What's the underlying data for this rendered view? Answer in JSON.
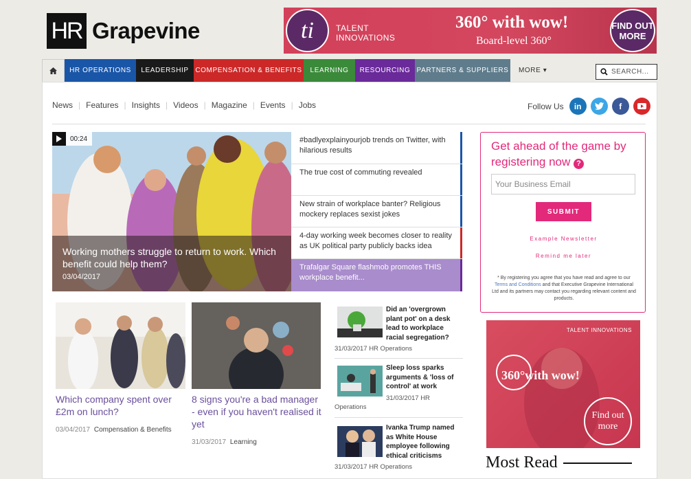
{
  "brand": {
    "logo_box": "HR",
    "logo_text": "Grapevine"
  },
  "top_ad": {
    "circle": "ti",
    "brand_line1": "TALENT",
    "brand_line2": "INNOVATIONS",
    "headline": "360° with wow!",
    "sub": "Board-level 360°",
    "cta": "FIND OUT MORE"
  },
  "nav": {
    "items": [
      {
        "label": "HR OPERATIONS",
        "color": "#1a56a8"
      },
      {
        "label": "LEADERSHIP",
        "color": "#1a1a1a"
      },
      {
        "label": "COMPENSATION & BENEFITS",
        "color": "#cc2828"
      },
      {
        "label": "LEARNING",
        "color": "#3a8a3a"
      },
      {
        "label": "RESOURCING",
        "color": "#6a2a9a"
      },
      {
        "label": "PARTNERS & SUPPLIERS",
        "color": "#5f7c8c"
      }
    ],
    "more": "MORE ▾",
    "search_placeholder": "SEARCH..."
  },
  "subnav": {
    "items": [
      "News",
      "Features",
      "Insights",
      "Videos",
      "Magazine",
      "Events",
      "Jobs"
    ]
  },
  "follow": {
    "label": "Follow Us"
  },
  "hero": {
    "duration": "00:24",
    "title": "Working mothers struggle to return to work. Which benefit could help them?",
    "date": "03/04/2017"
  },
  "headlines": [
    {
      "text": "#badlyexplainyourjob trends on Twitter, with hilarious results",
      "color": "#1a56a8"
    },
    {
      "text": "The true cost of commuting revealed",
      "color": "#1a56a8"
    },
    {
      "text": "New strain of workplace banter? Religious mockery replaces sexist jokes",
      "color": "#1a56a8"
    },
    {
      "text": "4-day working week becomes closer to reality as UK political party publicly backs idea",
      "color": "#cc2828"
    },
    {
      "text": "Trafalgar Square flashmob promotes THIS workplace benefit...",
      "color": "#6a2a9a"
    }
  ],
  "register": {
    "title": "Get ahead of the game by registering now",
    "email_placeholder": "Your Business Email",
    "submit": "SUBMIT",
    "example": "Example Newsletter",
    "remind": "Remind me later",
    "fine_1": "* By registering you agree that you have read and agree to our",
    "fine_link": "Terms and Conditions",
    "fine_2": "and that Executive Grapevine International Ltd and its partners may contact you regarding relevant content and products."
  },
  "side_ad": {
    "brand": "TALENT INNOVATIONS",
    "headline": "360°with wow!",
    "cta": "Find out more"
  },
  "most_read": "Most Read",
  "cards": [
    {
      "title": "Which company spent over £2m on lunch?",
      "date": "03/04/2017",
      "category": "Compensation & Benefits"
    },
    {
      "title": "8 signs you're a bad manager - even if you haven't realised it yet",
      "date": "31/03/2017",
      "category": "Learning"
    }
  ],
  "side_list": [
    {
      "title": "Did an 'overgrown plant pot' on a desk lead to workplace racial segregation?",
      "date": "31/03/2017",
      "category": "HR Operations"
    },
    {
      "title": "Sleep loss sparks arguments & 'loss of control' at work",
      "date": "31/03/2017",
      "category": "HR Operations"
    },
    {
      "title": "Ivanka Trump named as White House employee following ethical criticisms",
      "date": "31/03/2017",
      "category": "HR Operations"
    }
  ]
}
